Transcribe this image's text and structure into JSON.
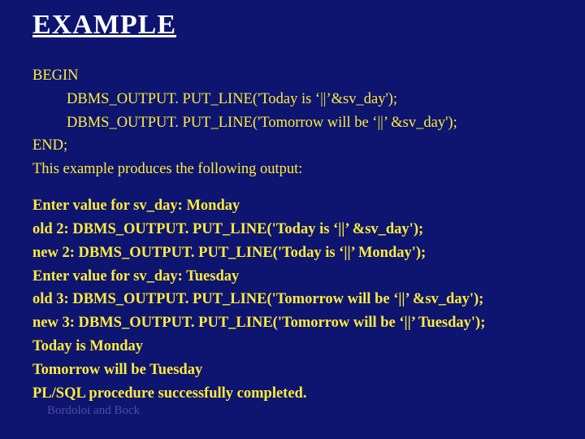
{
  "title": "EXAMPLE",
  "code": {
    "l1": "BEGIN",
    "l2": "DBMS_OUTPUT. PUT_LINE('Today is ‘||’&sv_day');",
    "l3": "DBMS_OUTPUT. PUT_LINE('Tomorrow will be ‘||’ &sv_day');",
    "l4": "END;",
    "l5": "This example produces the following output:"
  },
  "output": {
    "o1": "Enter value for sv_day: Monday",
    "o2": "old 2: DBMS_OUTPUT. PUT_LINE('Today is ‘||’ &sv_day');",
    "o3": "new 2: DBMS_OUTPUT. PUT_LINE('Today is ‘||’ Monday');",
    "o4": "Enter value for sv_day: Tuesday",
    "o5": "old 3: DBMS_OUTPUT. PUT_LINE('Tomorrow will be ‘||’ &sv_day');",
    "o6": "new 3: DBMS_OUTPUT. PUT_LINE('Tomorrow will be ‘||’ Tuesday');",
    "o7": "Today is Monday",
    "o8": "Tomorrow will be Tuesday",
    "o9": "PL/SQL procedure successfully completed."
  },
  "footer": "Bordoloi and Bock"
}
